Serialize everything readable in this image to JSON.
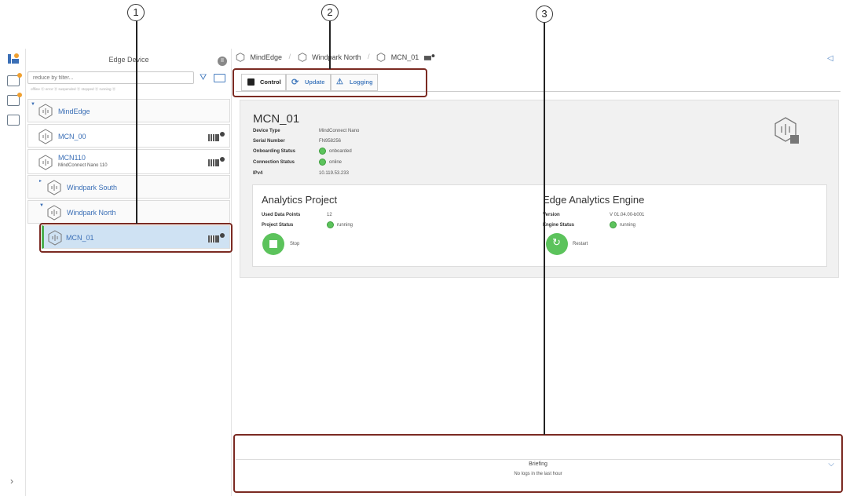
{
  "rail": {
    "icons": [
      "app-logo-icon",
      "monitoring-icon",
      "analytics-icon",
      "network-icon"
    ],
    "expand_glyph": "›"
  },
  "tree": {
    "header": "Edge Device",
    "pause_glyph": "II",
    "filter_placeholder": "reduce by filter...",
    "status_legend": "offline ⓪   error ⓪   suspended ⓪   stopped ⓪   running ⓪",
    "nodes": [
      {
        "label": "MindEdge",
        "sub": ""
      },
      {
        "label": "MCN_00",
        "sub": ""
      },
      {
        "label": "MCN110",
        "sub": "MindConnect Nano 110"
      },
      {
        "label": "Windpark South",
        "sub": ""
      },
      {
        "label": "Windpark North",
        "sub": ""
      },
      {
        "label": "MCN_01",
        "sub": ""
      }
    ]
  },
  "breadcrumb": {
    "items": [
      "MindEdge",
      "Windpark North",
      "MCN_01"
    ],
    "separator": "/"
  },
  "tabs": [
    {
      "label": "Control",
      "icon": "power-icon"
    },
    {
      "label": "Update",
      "icon": "refresh-icon"
    },
    {
      "label": "Logging",
      "icon": "warning-icon"
    }
  ],
  "device": {
    "title": "MCN_01",
    "properties": [
      {
        "key": "Device Type",
        "value": "MindConnect Nano"
      },
      {
        "key": "Serial Number",
        "value": "FN958256"
      },
      {
        "key": "Onboarding Status",
        "value": "onboarded"
      },
      {
        "key": "Connection Status",
        "value": "online"
      },
      {
        "key": "IPv4",
        "value": "10.119.53.233"
      }
    ]
  },
  "analytics_project": {
    "title": "Analytics Project",
    "used_data_points_label": "Used Data Points",
    "used_data_points_value": "12",
    "status_label": "Project Status",
    "status_value": "running",
    "button_label": "Stop"
  },
  "engine": {
    "title": "Edge Analytics Engine",
    "version_label": "Version",
    "version_value": "V 01.04.00-b001",
    "status_label": "Engine Status",
    "status_value": "running",
    "button_label": "Restart"
  },
  "logs": {
    "title": "Briefing",
    "message": "No logs in the last hour"
  },
  "annotations": [
    "1",
    "2",
    "3"
  ],
  "colors": {
    "accent": "#4a7fc0",
    "running": "#5cc35c",
    "annotation_box": "#7b2a22",
    "selection": "#cfe2f3"
  }
}
